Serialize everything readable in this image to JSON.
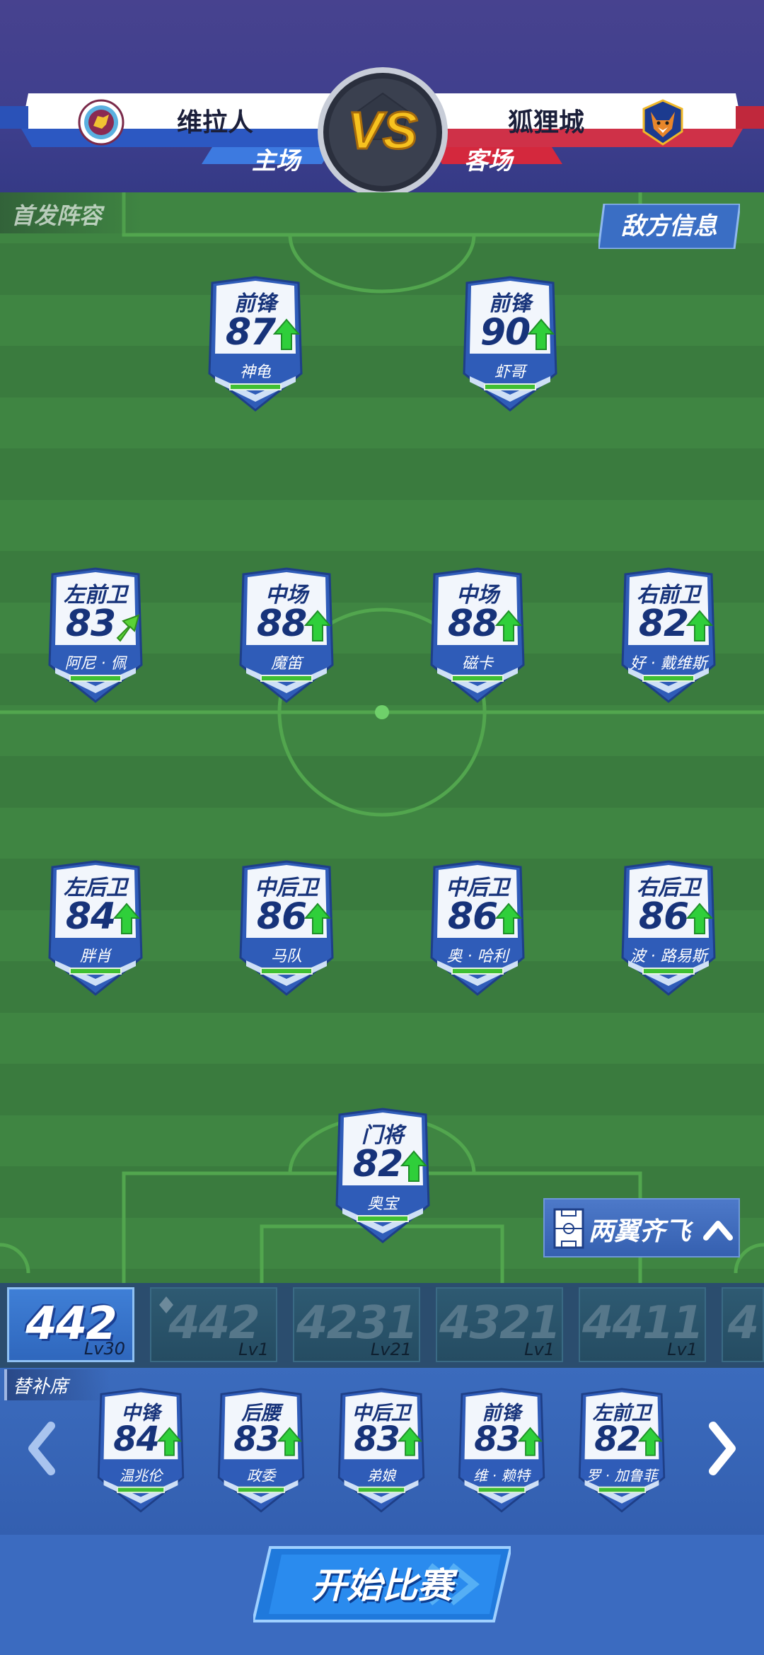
{
  "match": {
    "home": {
      "name": "维拉人",
      "side": "主场",
      "crest": "lion-crest-icon"
    },
    "away": {
      "name": "狐狸城",
      "side": "客场",
      "crest": "fox-crest-icon"
    },
    "vs_label": "VS"
  },
  "lineup_label": "首发阵容",
  "enemy_info_label": "敌方信息",
  "starters": {
    "forwards": [
      {
        "pos": "前锋",
        "rating": "87",
        "name": "神龟",
        "arrow": "up"
      },
      {
        "pos": "前锋",
        "rating": "90",
        "name": "虾哥",
        "arrow": "up"
      }
    ],
    "midfield": [
      {
        "pos": "左前卫",
        "rating": "83",
        "name": "阿尼 · 佩",
        "arrow": "diagonal"
      },
      {
        "pos": "中场",
        "rating": "88",
        "name": "魔笛",
        "arrow": "up"
      },
      {
        "pos": "中场",
        "rating": "88",
        "name": "磁卡",
        "arrow": "up"
      },
      {
        "pos": "右前卫",
        "rating": "82",
        "name": "好 · 戴维斯",
        "arrow": "up"
      }
    ],
    "defense": [
      {
        "pos": "左后卫",
        "rating": "84",
        "name": "胖肖",
        "arrow": "up"
      },
      {
        "pos": "中后卫",
        "rating": "86",
        "name": "马队",
        "arrow": "up"
      },
      {
        "pos": "中后卫",
        "rating": "86",
        "name": "奥 · 哈利",
        "arrow": "up"
      },
      {
        "pos": "右后卫",
        "rating": "86",
        "name": "波 · 路易斯",
        "arrow": "up"
      }
    ],
    "goalkeeper": {
      "pos": "门将",
      "rating": "82",
      "name": "奥宝",
      "arrow": "up"
    }
  },
  "tactic": {
    "label": "两翼齐飞"
  },
  "formations": [
    {
      "name": "442",
      "level": "Lv30",
      "active": true
    },
    {
      "name": "442",
      "level": "Lv1",
      "active": false,
      "icon": "diamond-icon"
    },
    {
      "name": "4231",
      "level": "Lv21",
      "active": false
    },
    {
      "name": "4321",
      "level": "Lv1",
      "active": false
    },
    {
      "name": "4411",
      "level": "Lv1",
      "active": false
    },
    {
      "name": "4",
      "level": "",
      "active": false
    }
  ],
  "bench": {
    "label": "替补席",
    "players": [
      {
        "pos": "中锋",
        "rating": "84",
        "name": "温兆伦",
        "arrow": "up"
      },
      {
        "pos": "后腰",
        "rating": "83",
        "name": "政委",
        "arrow": "up"
      },
      {
        "pos": "中后卫",
        "rating": "83",
        "name": "弟娘",
        "arrow": "up"
      },
      {
        "pos": "前锋",
        "rating": "83",
        "name": "维 · 赖特",
        "arrow": "up"
      },
      {
        "pos": "左前卫",
        "rating": "82",
        "name": "罗 · 加鲁菲",
        "arrow": "up"
      }
    ]
  },
  "start_button": "开始比赛",
  "colors": {
    "card_blue": "#2f5cb8",
    "card_white": "#f2f6fc",
    "rating_text": "#17337a",
    "arrow_green": "#2fcf3a",
    "pitch_light": "#3f8542",
    "pitch_dark": "#3a7b3e"
  }
}
